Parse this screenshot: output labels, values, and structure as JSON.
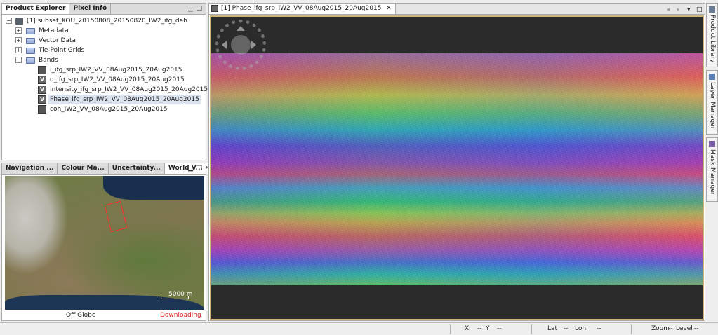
{
  "product_explorer": {
    "tabs": [
      "Product Explorer",
      "Pixel Info"
    ],
    "product": "[1] subset_KOU_20150808_20150820_IW2_ifg_deb",
    "nodes": [
      "Metadata",
      "Vector Data",
      "Tie-Point Grids",
      "Bands"
    ],
    "bands": [
      "i_ifg_srp_IW2_VV_08Aug2015_20Aug2015",
      "q_ifg_srp_IW2_VV_08Aug2015_20Aug2015",
      "Intensity_ifg_srp_IW2_VV_08Aug2015_20Aug2015",
      "Phase_ifg_srp_IW2_VV_08Aug2015_20Aug2015",
      "coh_IW2_VV_08Aug2015_20Aug2015"
    ],
    "band_badge": "V"
  },
  "bottom_panel": {
    "tabs": [
      "Navigation ...",
      "Colour Ma...",
      "Uncertainty...",
      "World V..."
    ],
    "close_glyph": "✕",
    "scale_label": "5000 m",
    "globe_mode": "Off Globe",
    "download_status": "Downloading",
    "download_color": "#e02020"
  },
  "image_view": {
    "tab_title": "[1] Phase_ifg_srp_IW2_VV_08Aug2015_20Aug2015",
    "controls": [
      "◂",
      "▸",
      "▾",
      "□"
    ]
  },
  "right_sidebar": {
    "tabs": [
      "Product Library",
      "Layer Manager",
      "Mask Manager"
    ]
  },
  "status_bar": {
    "x_label": "X",
    "x_value": "--",
    "y_label": "Y",
    "y_value": "--",
    "lat_label": "Lat",
    "lat_value": "--",
    "lon_label": "Lon",
    "lon_value": "--",
    "zoom_label": "Zoom",
    "zoom_value": "--",
    "level_label": "Level",
    "level_value": "--"
  },
  "colors": {
    "selection": "#dbe3ee",
    "frame": "#cdb57a",
    "nodata": "#2b2b2b"
  }
}
